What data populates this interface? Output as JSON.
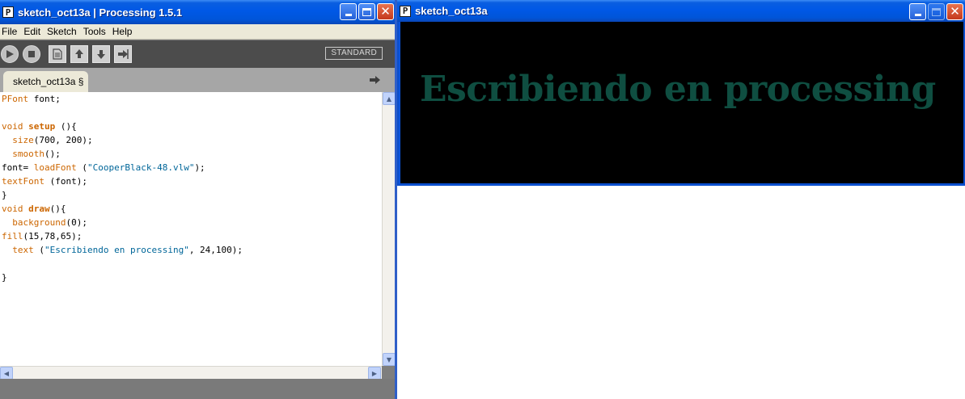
{
  "editor": {
    "title": "sketch_oct13a | Processing 1.5.1",
    "icon_letter": "P",
    "menu": [
      "File",
      "Edit",
      "Sketch",
      "Tools",
      "Help"
    ],
    "toolbar": {
      "buttons": [
        "run-icon",
        "stop-icon",
        "new-icon",
        "open-icon",
        "save-icon",
        "export-icon"
      ],
      "mode": "STANDARD"
    },
    "tab_label": "sketch_oct13a §",
    "code": [
      "PFont font;",
      "",
      "void setup (){",
      "  size(700, 200);",
      "  smooth();",
      "font= loadFont (\"CooperBlack-48.vlw\");",
      "textFont (font);",
      "}",
      "void draw(){",
      "  background(0);",
      "fill(15,78,65);",
      "  text (\"Escribiendo en processing\", 24,100);",
      "",
      "}"
    ]
  },
  "sketch": {
    "title": "sketch_oct13a",
    "icon_letter": "P",
    "canvas_text": "Escribiendo en processing",
    "canvas_background": "#000000",
    "text_color": "#0f4e41"
  },
  "colors": {
    "titlebar": "#0058e6",
    "toolbar": "#4c4c4c",
    "keyword": "#cc6600",
    "string": "#006699"
  }
}
